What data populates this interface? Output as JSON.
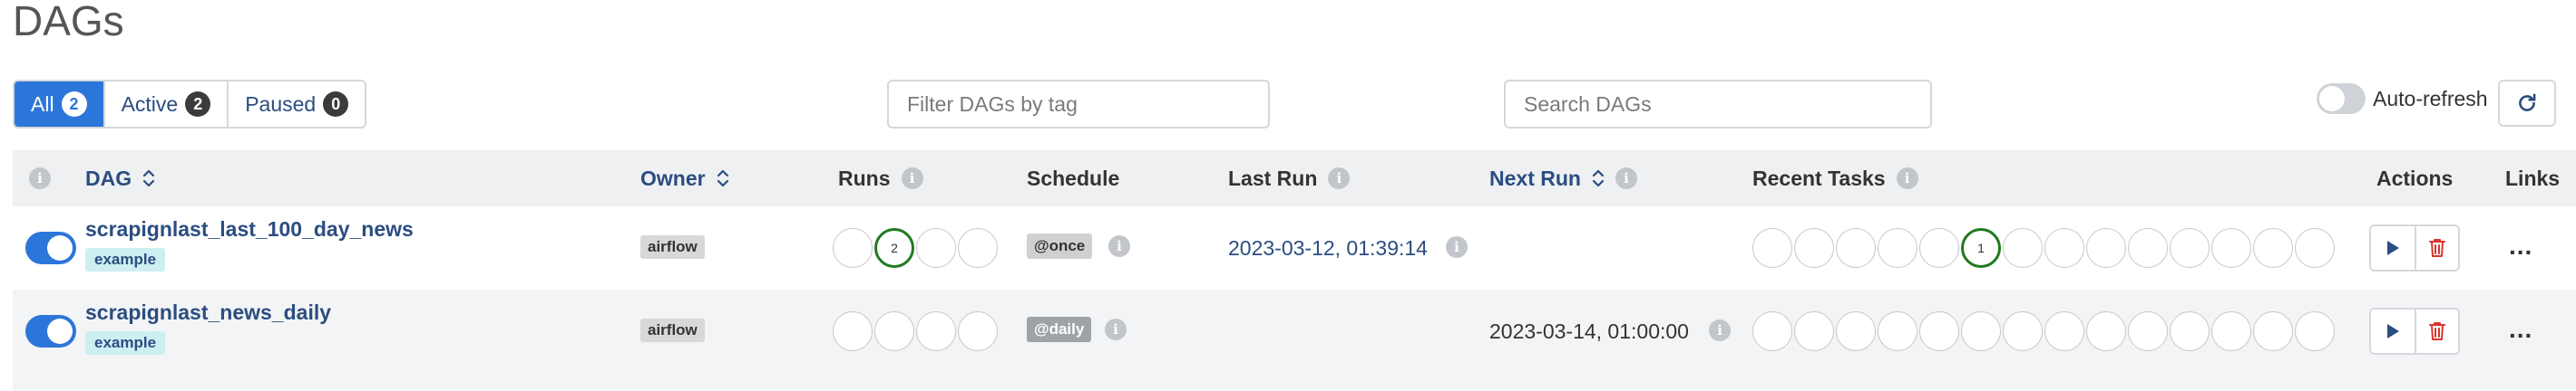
{
  "page": {
    "title": "DAGs"
  },
  "filters": {
    "tabs": [
      {
        "label": "All",
        "count": "2",
        "active": true
      },
      {
        "label": "Active",
        "count": "2",
        "active": false
      },
      {
        "label": "Paused",
        "count": "0",
        "active": false
      }
    ],
    "tag_placeholder": "Filter DAGs by tag",
    "search_placeholder": "Search DAGs",
    "auto_refresh_label": "Auto-refresh"
  },
  "table": {
    "columns": {
      "dag": "DAG",
      "owner": "Owner",
      "runs": "Runs",
      "schedule": "Schedule",
      "last_run": "Last Run",
      "next_run": "Next Run",
      "recent_tasks": "Recent Tasks",
      "actions": "Actions",
      "links": "Links"
    },
    "rows": [
      {
        "dag_id": "scrapignlast_last_100_day_news",
        "tag": "example",
        "owner": "airflow",
        "runs": [
          "",
          "2",
          "",
          ""
        ],
        "schedule": "@once",
        "last_run": "2023-03-12, 01:39:14",
        "next_run": "",
        "recent_tasks": [
          "",
          "",
          "",
          "",
          "",
          "1",
          "",
          "",
          "",
          "",
          "",
          "",
          "",
          ""
        ],
        "links_label": "..."
      },
      {
        "dag_id": "scrapignlast_news_daily",
        "tag": "example",
        "owner": "airflow",
        "runs": [
          "",
          "",
          "",
          ""
        ],
        "schedule": "@daily",
        "last_run": "",
        "next_run": "2023-03-14, 01:00:00",
        "recent_tasks": [
          "",
          "",
          "",
          "",
          "",
          "",
          "",
          "",
          "",
          "",
          "",
          "",
          "",
          ""
        ],
        "links_label": "..."
      }
    ]
  },
  "colors": {
    "primary": "#2d76d9",
    "link": "#2b4d80",
    "success": "#1f7a1f",
    "delete": "#d9342b",
    "tag_bg": "#cdeff2"
  },
  "icons": {
    "sort": "sort-icon",
    "info": "info-icon",
    "refresh": "refresh-icon",
    "trigger": "play-icon",
    "delete": "trash-icon"
  }
}
